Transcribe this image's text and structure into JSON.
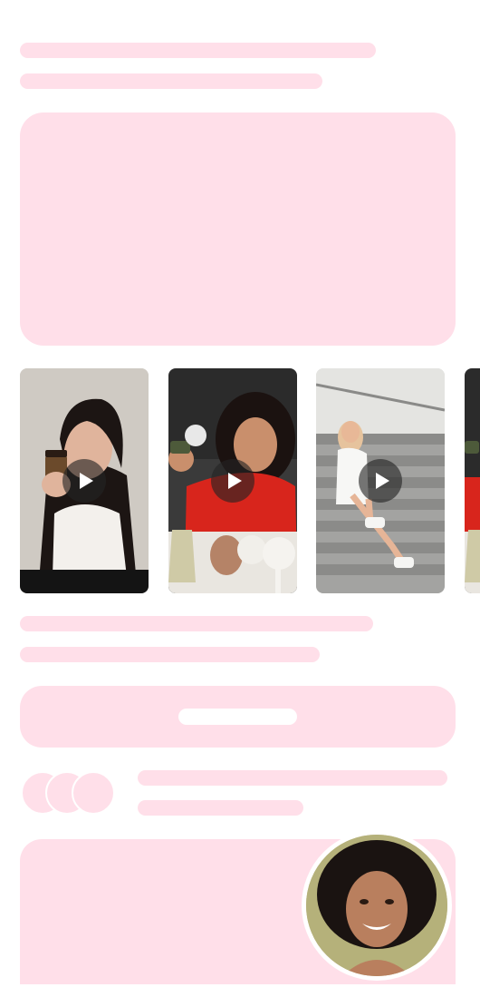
{
  "theme": {
    "skeleton_color": "#ffdfe9",
    "background": "#ffffff",
    "play_overlay": "#232323"
  },
  "header": {
    "title_line": "",
    "subtitle_line": ""
  },
  "hero_banner": {
    "content": ""
  },
  "video_carousel": {
    "items": [
      {
        "icon": "play-icon",
        "subject": "woman-holding-cup"
      },
      {
        "icon": "play-icon",
        "subject": "woman-red-sweater-holding-jar"
      },
      {
        "icon": "play-icon",
        "subject": "woman-sitting-on-stairs"
      },
      {
        "icon": "play-icon",
        "subject": "partial-card"
      }
    ]
  },
  "description": {
    "line_1": "",
    "line_2": ""
  },
  "cta_button": {
    "label": ""
  },
  "social_proof": {
    "avatar_count": 3,
    "line_1": "",
    "line_2": ""
  },
  "profile_card": {
    "photo": "smiling-woman-portrait"
  }
}
